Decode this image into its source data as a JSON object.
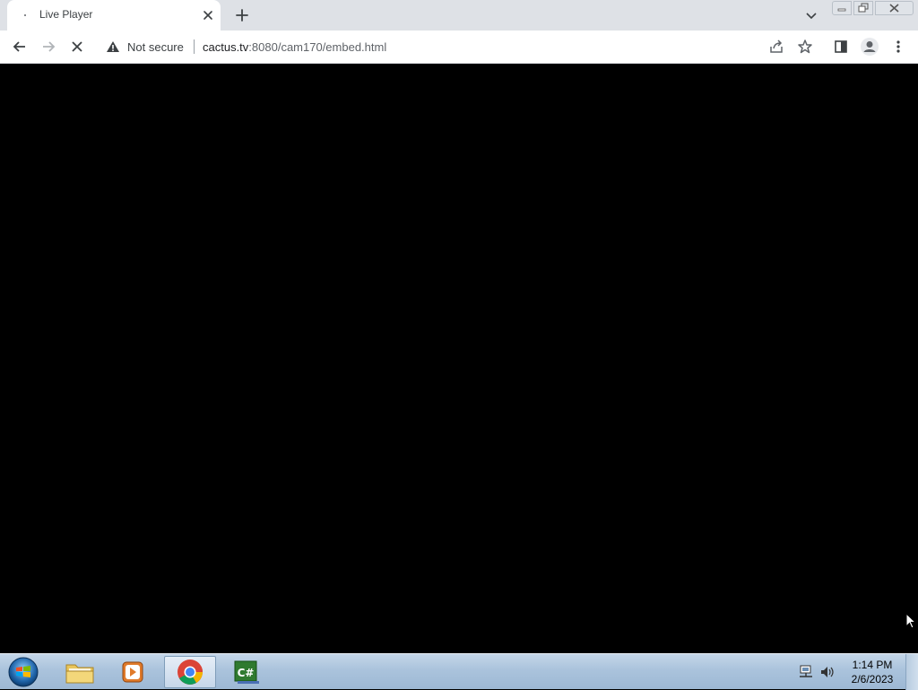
{
  "browser": {
    "tab": {
      "title": "Live Player",
      "close_icon": "close-icon"
    },
    "new_tab_icon": "plus-icon",
    "tab_search_icon": "chevron-down-icon",
    "window_controls": [
      "minimize",
      "maximize",
      "close"
    ]
  },
  "toolbar": {
    "back_icon": "arrow-left-icon",
    "forward_icon": "arrow-right-icon",
    "stop_icon": "x-icon",
    "security": {
      "icon": "warning-triangle-icon",
      "label": "Not secure"
    },
    "url": {
      "host": "cactus.tv",
      "rest": ":8080/cam170/embed.html"
    },
    "share_icon": "share-icon",
    "bookmark_icon": "star-icon",
    "side_panel_icon": "side-panel-icon",
    "profile_icon": "profile-icon",
    "menu_icon": "kebab-menu-icon"
  },
  "content": {
    "background": "#000000"
  },
  "taskbar": {
    "apps": [
      "windows-start",
      "file-explorer",
      "media-player",
      "google-chrome",
      "csharp-ide"
    ],
    "active_app": "google-chrome",
    "tray_icons": [
      "network-icon",
      "volume-icon"
    ],
    "clock": {
      "time": "1:14 PM",
      "date": "2/6/2023"
    }
  },
  "colors": {
    "tab_strip": "#dee1e6",
    "toolbar": "#ffffff",
    "content": "#000000",
    "taskbar": "#aac3dc"
  }
}
